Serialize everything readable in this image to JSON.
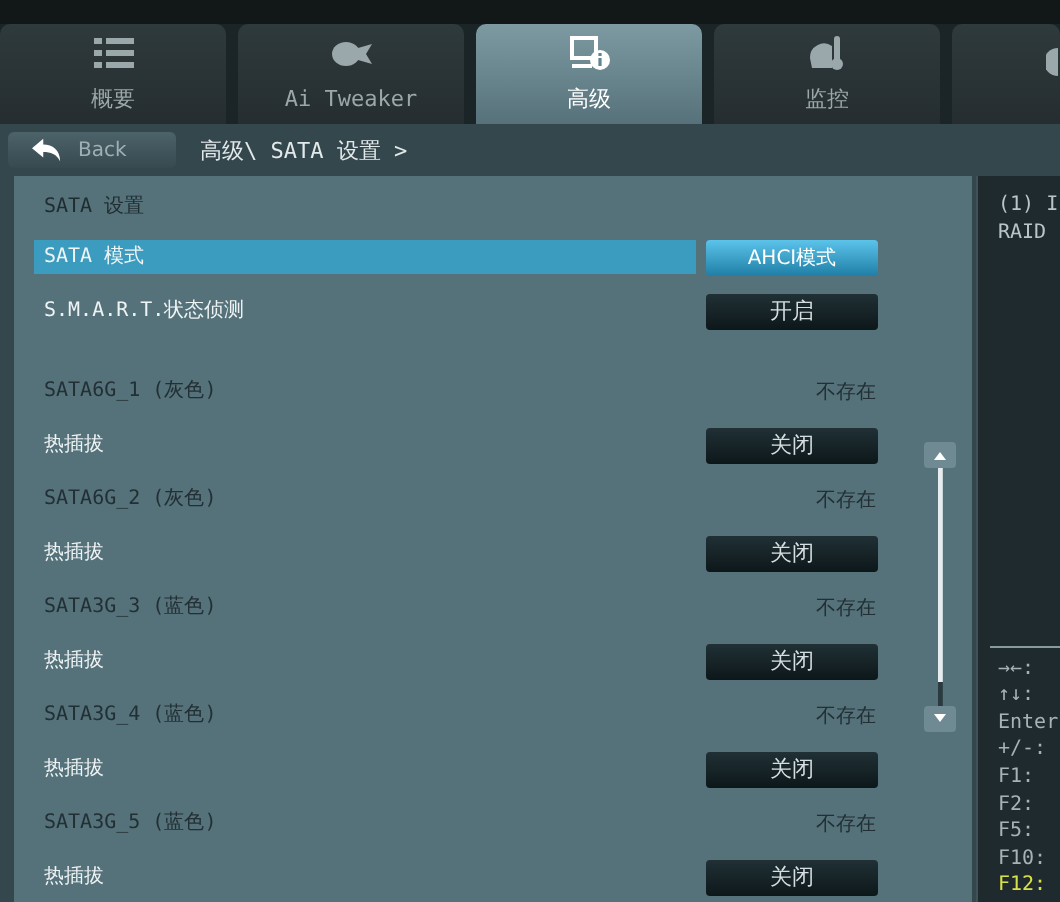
{
  "tabs": [
    {
      "label": "概要",
      "selected": false
    },
    {
      "label": "Ai Tweaker",
      "selected": false
    },
    {
      "label": "高级",
      "selected": true
    },
    {
      "label": "监控",
      "selected": false
    },
    {
      "selected": false
    }
  ],
  "back_button": "Back",
  "breadcrumb": "高级\\ SATA 设置 >",
  "section_title": "SATA 设置",
  "groups": [
    [
      {
        "kind": "option",
        "label": "SATA 模式",
        "value": "AHCI模式",
        "selected": true
      },
      {
        "kind": "option",
        "label": "S.M.A.R.T.状态侦测",
        "value": "开启",
        "selected": false
      }
    ],
    [
      {
        "kind": "status",
        "label": "SATA6G_1 (灰色)",
        "value": "不存在",
        "selected": false
      },
      {
        "kind": "option",
        "label": "热插拔",
        "value": "关闭",
        "selected": false
      },
      {
        "kind": "status",
        "label": "SATA6G_2 (灰色)",
        "value": "不存在",
        "selected": false
      },
      {
        "kind": "option",
        "label": "热插拔",
        "value": "关闭",
        "selected": false
      },
      {
        "kind": "status",
        "label": "SATA3G_3 (蓝色)",
        "value": "不存在",
        "selected": false
      },
      {
        "kind": "option",
        "label": "热插拔",
        "value": "关闭",
        "selected": false
      },
      {
        "kind": "status",
        "label": "SATA3G_4 (蓝色)",
        "value": "不存在",
        "selected": false
      },
      {
        "kind": "option",
        "label": "热插拔",
        "value": "关闭",
        "selected": false
      },
      {
        "kind": "status",
        "label": "SATA3G_5 (蓝色)",
        "value": "不存在",
        "selected": false
      },
      {
        "kind": "option",
        "label": "热插拔",
        "value": "关闭",
        "selected": false
      }
    ]
  ],
  "help_text": [
    "(1) I",
    "RAID"
  ],
  "key_hints": [
    {
      "text": "→←:",
      "highlight": false
    },
    {
      "text": "↑↓:",
      "highlight": false
    },
    {
      "text": "Enter",
      "highlight": false
    },
    {
      "text": "+/-:",
      "highlight": false
    },
    {
      "text": "F1:",
      "highlight": false
    },
    {
      "text": "F2:",
      "highlight": false
    },
    {
      "text": "F5:",
      "highlight": false
    },
    {
      "text": "F10:",
      "highlight": false
    },
    {
      "text": "F12:",
      "highlight": true
    }
  ]
}
